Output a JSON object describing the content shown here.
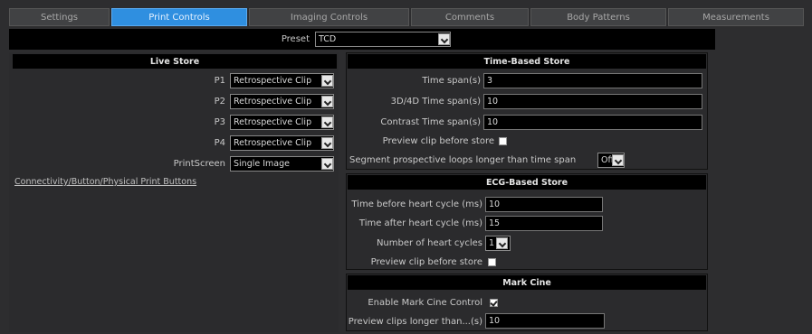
{
  "tabs": [
    {
      "label": "Settings",
      "active": false
    },
    {
      "label": "Print Controls",
      "active": true
    },
    {
      "label": "Imaging Controls",
      "active": false
    },
    {
      "label": "Comments",
      "active": false
    },
    {
      "label": "Body Patterns",
      "active": false
    },
    {
      "label": "Measurements",
      "active": false
    }
  ],
  "preset": {
    "label": "Preset",
    "value": "TCD"
  },
  "live_store": {
    "title": "Live Store",
    "rows": [
      {
        "label": "P1",
        "value": "Retrospective Clip"
      },
      {
        "label": "P2",
        "value": "Retrospective Clip"
      },
      {
        "label": "P3",
        "value": "Retrospective Clip"
      },
      {
        "label": "P4",
        "value": "Retrospective Clip"
      },
      {
        "label": "PrintScreen",
        "value": "Single Image"
      }
    ],
    "link": "Connectivity/Button/Physical Print Buttons"
  },
  "time_based": {
    "title": "Time-Based Store",
    "time_span_label": "Time span(s)",
    "time_span_value": "3",
    "span_3d4d_label": "3D/4D Time span(s)",
    "span_3d4d_value": "10",
    "contrast_label": "Contrast Time span(s)",
    "contrast_value": "10",
    "preview_label": "Preview clip before store",
    "preview_checked": false,
    "segment_label": "Segment prospective loops longer than time span",
    "segment_value": "Off"
  },
  "ecg_based": {
    "title": "ECG-Based Store",
    "before_label": "Time before heart cycle (ms)",
    "before_value": "10",
    "after_label": "Time after heart cycle (ms)",
    "after_value": "15",
    "cycles_label": "Number of heart cycles",
    "cycles_value": "1",
    "preview_label": "Preview clip before store",
    "preview_checked": false
  },
  "mark_cine": {
    "title": "Mark Cine",
    "enable_label": "Enable Mark Cine Control",
    "enable_checked": true,
    "preview_label": "Preview clips longer than...(s)",
    "preview_value": "10"
  },
  "colors": {
    "active_tab": "#2f8fe0",
    "background": "#2d2d2f",
    "panel_head": "#000000"
  }
}
